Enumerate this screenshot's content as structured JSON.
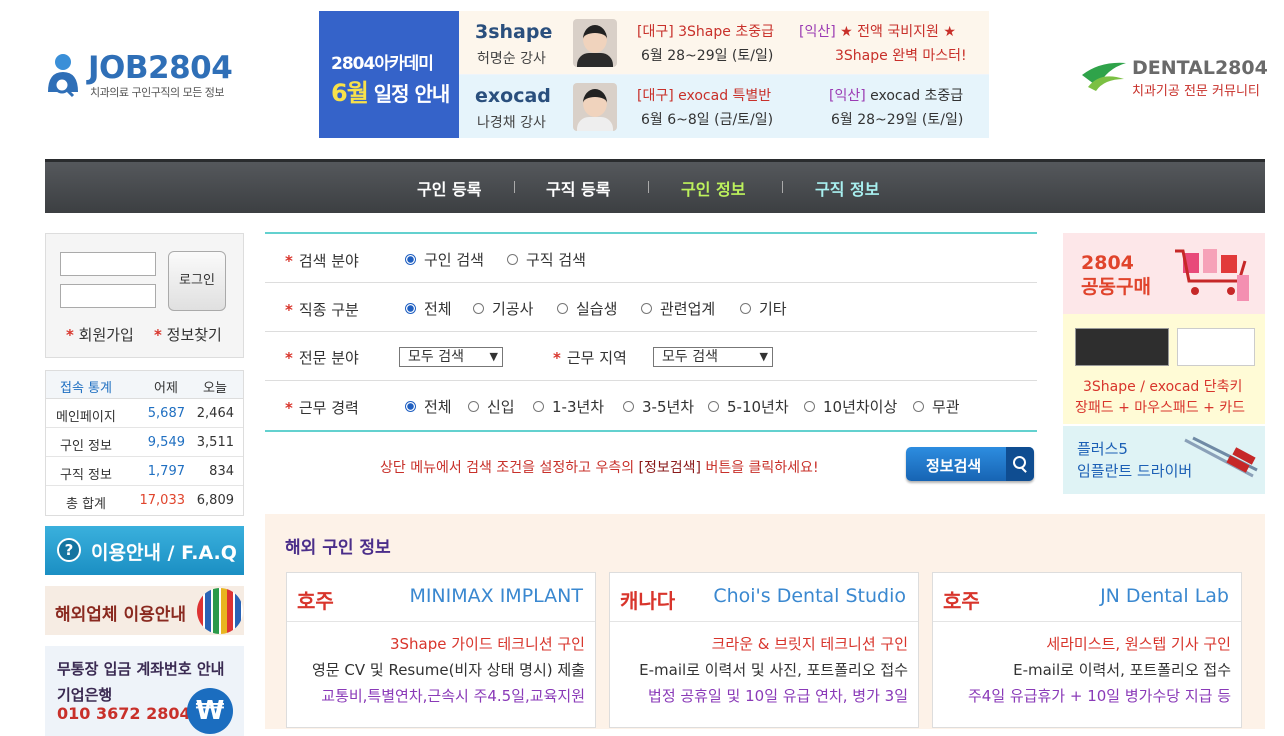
{
  "header": {
    "logo_name": "JOB2804",
    "logo_sub": "치과의료 구인구직의 모든 정보",
    "banner": {
      "left_line1": "2804아카데미",
      "left_month": "6월",
      "left_line2": " 일정 안내",
      "row1": {
        "brand": "3shape",
        "teacher": "허명순 강사",
        "c1": "[대구] 3Shape 초중급",
        "c1_date": "6월 28~29일 (토/일)",
        "c2_region": "[익산]",
        "c2": " ★ 전액 국비지원 ★",
        "c2_sub": "3Shape 완벽 마스터!"
      },
      "row2": {
        "brand": "exocad",
        "teacher": "나경채 강사",
        "c1": "[대구] exocad 특별반",
        "c1_date": "6월 6~8일 (금/토/일)",
        "c2_region": "[익산]",
        "c2": " exocad 초중급",
        "c2_sub": "6월 28~29일 (토/일)"
      }
    },
    "dental_name": "DENTAL2804",
    "dental_sub": "치과기공 전문 커뮤니티"
  },
  "nav": [
    "구인 등록",
    "구직 등록",
    "구인 정보",
    "구직 정보"
  ],
  "login": {
    "button": "로그인",
    "join": "회원가입",
    "find": "정보찾기",
    "star": "*"
  },
  "stats": {
    "headers": [
      "접속 통계",
      "어제",
      "오늘"
    ],
    "rows": [
      {
        "label": "메인페이지",
        "yesterday": "5,687",
        "today": "2,464"
      },
      {
        "label": "구인 정보",
        "yesterday": "9,549",
        "today": "3,511"
      },
      {
        "label": "구직 정보",
        "yesterday": "1,797",
        "today": "834"
      },
      {
        "label": "총 합계",
        "yesterday": "17,033",
        "today": "6,809"
      }
    ]
  },
  "faq": {
    "icon": "?",
    "label": "이용안내 / F.A.Q"
  },
  "overseas_guide": "해외업체 이용안내",
  "bank": {
    "title": "무통장 입금 계좌번호 안내",
    "bank": "기업은행",
    "account": "010 3672 2804",
    "icon": "₩"
  },
  "search": {
    "field_label": "검색 분야",
    "field_options": [
      "구인 검색",
      "구직 검색"
    ],
    "job_label": "직종 구분",
    "job_options": [
      "전체",
      "기공사",
      "실습생",
      "관련업계",
      "기타"
    ],
    "spec_label": "전문 분야",
    "spec_value": "모두 검색",
    "region_label": "근무 지역",
    "region_value": "모두 검색",
    "career_label": "근무 경력",
    "career_options": [
      "전체",
      "신입",
      "1-3년차",
      "3-5년차",
      "5-10년차",
      "10년차이상",
      "무관"
    ],
    "hint_pre": "상단 메뉴에서 검색 조건을 설정하고 우측의 ",
    "hint_key": "[정보검색]",
    "hint_post": " 버튼을 클릭하세요!",
    "button": "정보검색"
  },
  "ads": {
    "ad1_line1": "2804",
    "ad1_line2": "공동구매",
    "ad2_line1": "3Shape / exocad 단축키",
    "ad2_line2": "장패드 + 마우스패드 + 카드",
    "ad3_line1": "플러스5",
    "ad3_line2": "임플란트 드라이버"
  },
  "overseas": {
    "title": "해외 구인 정보",
    "cards": [
      {
        "country": "호주",
        "company": "MINIMAX IMPLANT",
        "l1": "3Shape 가이드 테크니션 구인",
        "l2": "영문 CV 및 Resume(비자 상태 명시) 제출",
        "l3": "교통비,특별연차,근속시 주4.5일,교육지원"
      },
      {
        "country": "캐나다",
        "company": "Choi's Dental Studio",
        "l1": "크라운 & 브릿지 테크니션 구인",
        "l2": "E-mail로 이력서 및 사진, 포트폴리오 접수",
        "l3": "법정 공휴일 및 10일 유급 연차, 병가 3일"
      },
      {
        "country": "호주",
        "company": "JN Dental Lab",
        "l1": "세라미스트, 원스텝 기사 구인",
        "l2": "E-mail로 이력서, 포트폴리오 접수",
        "l3": "주4일 유급휴가 + 10일 병가수당 지급 등"
      }
    ]
  }
}
